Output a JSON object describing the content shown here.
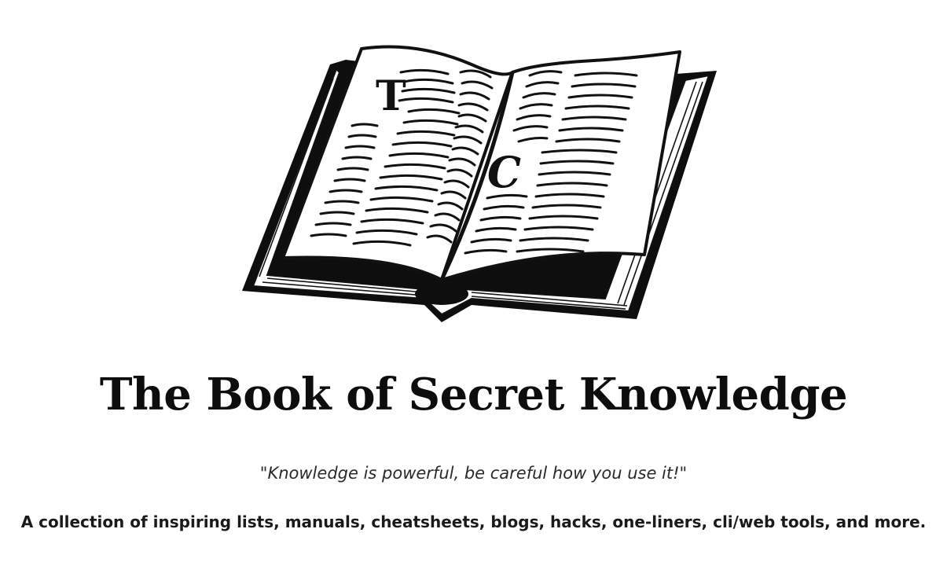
{
  "header": {
    "title": "The Book of Secret Knowledge",
    "quote": "\"Knowledge is powerful, be careful how you use it!\"",
    "description": "A collection of inspiring lists, manuals, cheatsheets, blogs, hacks, one-liners, cli/web tools, and more."
  },
  "illustration": {
    "icon": "open-book-icon",
    "left_initial": "T",
    "right_initial": "C"
  }
}
